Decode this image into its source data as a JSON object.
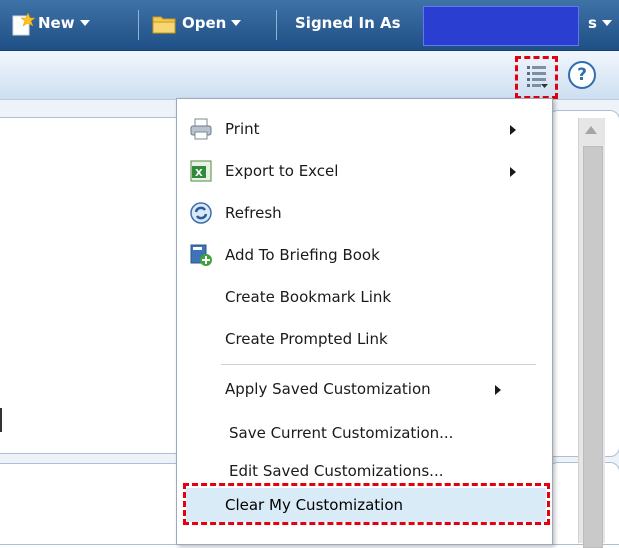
{
  "topbar": {
    "new_label": "New",
    "open_label": "Open",
    "signed_in_label": "Signed In As",
    "signed_in_value": ""
  },
  "menu": {
    "items": [
      {
        "label": "Print",
        "icon": "printer-icon",
        "submenu": true
      },
      {
        "label": "Export to Excel",
        "icon": "excel-icon",
        "submenu": true
      },
      {
        "label": "Refresh",
        "icon": "refresh-icon",
        "submenu": false
      },
      {
        "label": "Add To Briefing Book",
        "icon": "briefing-book-add-icon",
        "submenu": false
      },
      {
        "label": "Create Bookmark Link",
        "icon": "",
        "submenu": false
      },
      {
        "label": "Create Prompted Link",
        "icon": "",
        "submenu": false
      },
      {
        "label": "Apply Saved Customization",
        "icon": "",
        "submenu": true
      },
      {
        "label": "Save Current Customization...",
        "icon": "",
        "submenu": false
      },
      {
        "label": "Edit Saved Customizations...",
        "icon": "",
        "submenu": false
      },
      {
        "label": "Clear My Customization",
        "icon": "",
        "submenu": false
      }
    ]
  },
  "colors": {
    "topbar": "#2d5f96",
    "highlight": "#e3000f",
    "menu_active": "#d9ebf7"
  }
}
